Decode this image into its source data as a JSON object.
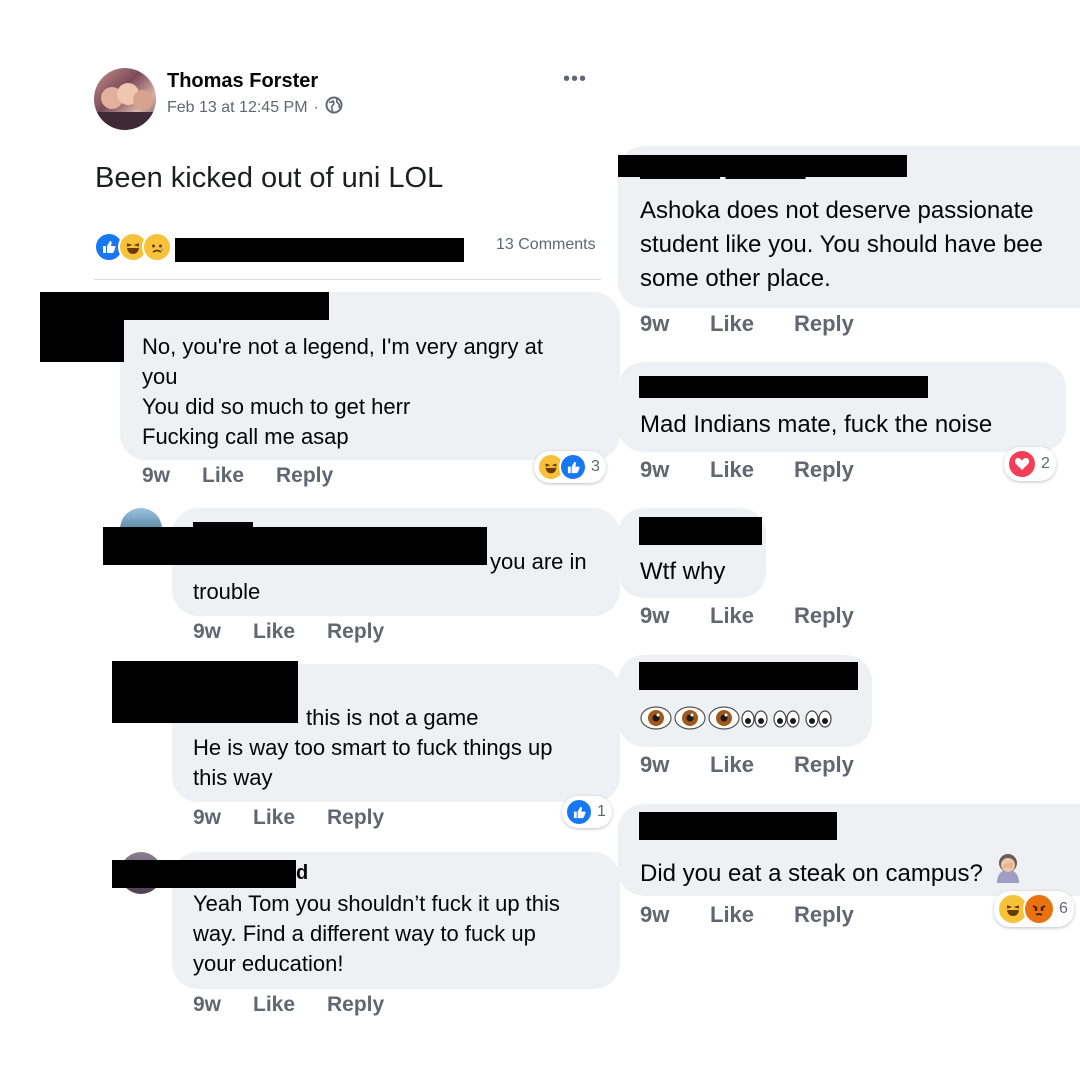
{
  "post": {
    "author": "Thomas Forster",
    "timestamp": "Feb 13 at 12:45 PM",
    "separator": "·",
    "text": "Been kicked out of uni LOL",
    "comments_count": "13 Comments",
    "more_options": "•••"
  },
  "left_comments": [
    {
      "lines": [
        "No, you're not a legend, I'm very angry at",
        "you",
        "You did so much to get herr",
        "Fucking call me asap"
      ],
      "time": "9w",
      "like": "Like",
      "reply": "Reply",
      "reaction_count": "3"
    },
    {
      "lines": [
        "you are in",
        "trouble"
      ],
      "time": "9w",
      "like": "Like",
      "reply": "Reply"
    },
    {
      "lines": [
        "this is not a game",
        "He is way too smart to fuck things up",
        "this way"
      ],
      "time": "9w",
      "like": "Like",
      "reply": "Reply",
      "reaction_count": "1"
    },
    {
      "name_tail": "d",
      "lines": [
        "Yeah Tom you shouldn’t fuck it up this",
        "way.  Find a different way to fuck up",
        "your education!"
      ],
      "time": "9w",
      "like": "Like",
      "reply": "Reply"
    }
  ],
  "right_comments": [
    {
      "lines": [
        "Ashoka does not deserve passionate",
        "student like you. You should have bee",
        "some other place."
      ],
      "time": "9w",
      "like": "Like",
      "reply": "Reply"
    },
    {
      "lines": [
        "Mad Indians mate, fuck the noise"
      ],
      "time": "9w",
      "like": "Like",
      "reply": "Reply",
      "reaction_count": "2"
    },
    {
      "lines": [
        "Wtf why"
      ],
      "time": "9w",
      "like": "Like",
      "reply": "Reply"
    },
    {
      "emoji_line": [
        "eye-brown",
        "eye-brown",
        "eye-brown",
        "eye-small",
        "eye-small",
        "eye-small",
        "eye-small",
        "eye-small",
        "eye-small"
      ],
      "time": "9w",
      "like": "Like",
      "reply": "Reply"
    },
    {
      "lines": [
        "Did you eat a steak on campus?"
      ],
      "time": "9w",
      "like": "Like",
      "reply": "Reply",
      "reaction_count": "6"
    }
  ],
  "icons": [
    "more-options-icon",
    "globe-icon",
    "like-icon",
    "haha-icon",
    "sad-icon",
    "love-icon",
    "angry-icon",
    "eyes-emoji-icon",
    "facepalm-emoji-icon"
  ],
  "colors": {
    "bubble": "#eff0f3",
    "like_blue": "#1877f2",
    "love_red": "#f33e58",
    "haha_yellow": "#f7c23a",
    "angry_orange": "#e9710f"
  }
}
